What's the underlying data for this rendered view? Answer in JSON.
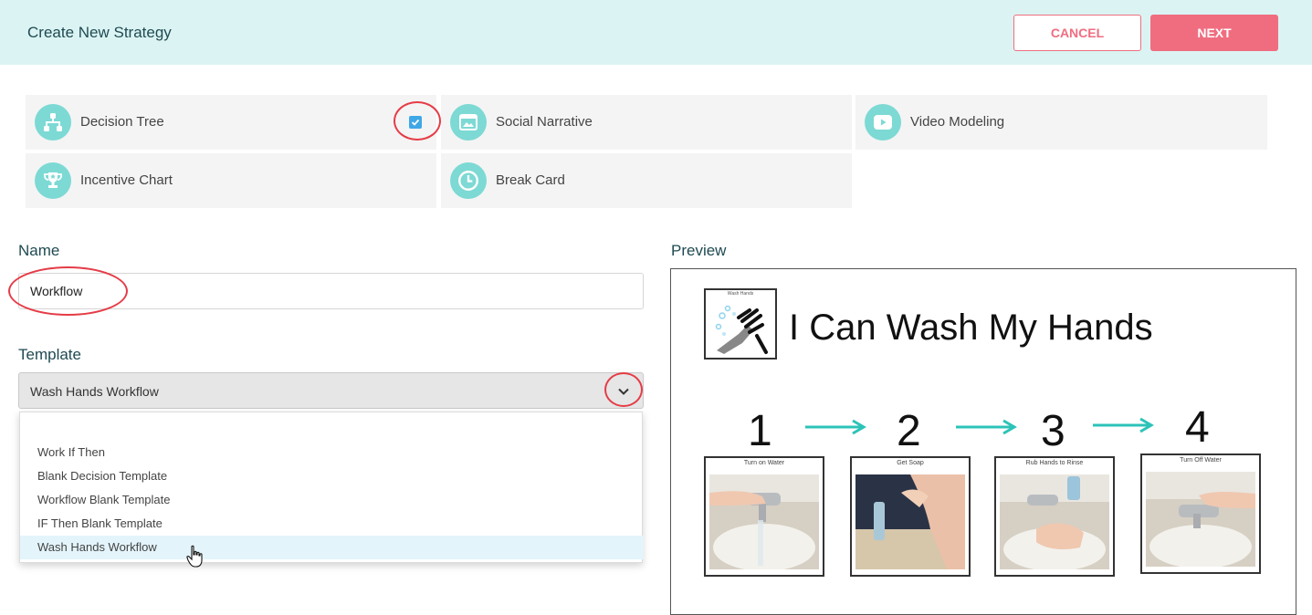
{
  "header": {
    "title": "Create New Strategy",
    "cancel_label": "CANCEL",
    "next_label": "NEXT"
  },
  "strategy_types": [
    {
      "label": "Decision Tree",
      "icon": "decision-tree-icon",
      "checked": true
    },
    {
      "label": "Social Narrative",
      "icon": "image-icon",
      "checked": false
    },
    {
      "label": "Video Modeling",
      "icon": "play-icon",
      "checked": false
    },
    {
      "label": "Incentive Chart",
      "icon": "trophy-icon",
      "checked": false
    },
    {
      "label": "Break Card",
      "icon": "clock-icon",
      "checked": false
    }
  ],
  "form": {
    "name_label": "Name",
    "name_value": "Workflow",
    "template_label": "Template",
    "template_value": "Wash Hands Workflow",
    "template_options": [
      "Work If Then",
      "Blank Decision Template",
      "Workflow Blank Template",
      "IF Then Blank Template",
      "Wash Hands Workflow"
    ],
    "selected_option": "Wash Hands Workflow"
  },
  "preview": {
    "label": "Preview",
    "title": "I Can Wash My Hands",
    "logo_caption": "Wash Hands",
    "steps": [
      {
        "number": "1",
        "caption": "Turn on Water"
      },
      {
        "number": "2",
        "caption": "Get Soap"
      },
      {
        "number": "3",
        "caption": "Rub Hands to Rinse"
      },
      {
        "number": "4",
        "caption": "Turn Off Water"
      }
    ]
  },
  "colors": {
    "header_bg": "#dbf4f3",
    "accent_pink": "#f06d80",
    "icon_teal": "#7dd9d4",
    "arrow_teal": "#2cc3b8",
    "annotation_red": "#e53c47",
    "checkbox_blue": "#3fa7e6"
  }
}
